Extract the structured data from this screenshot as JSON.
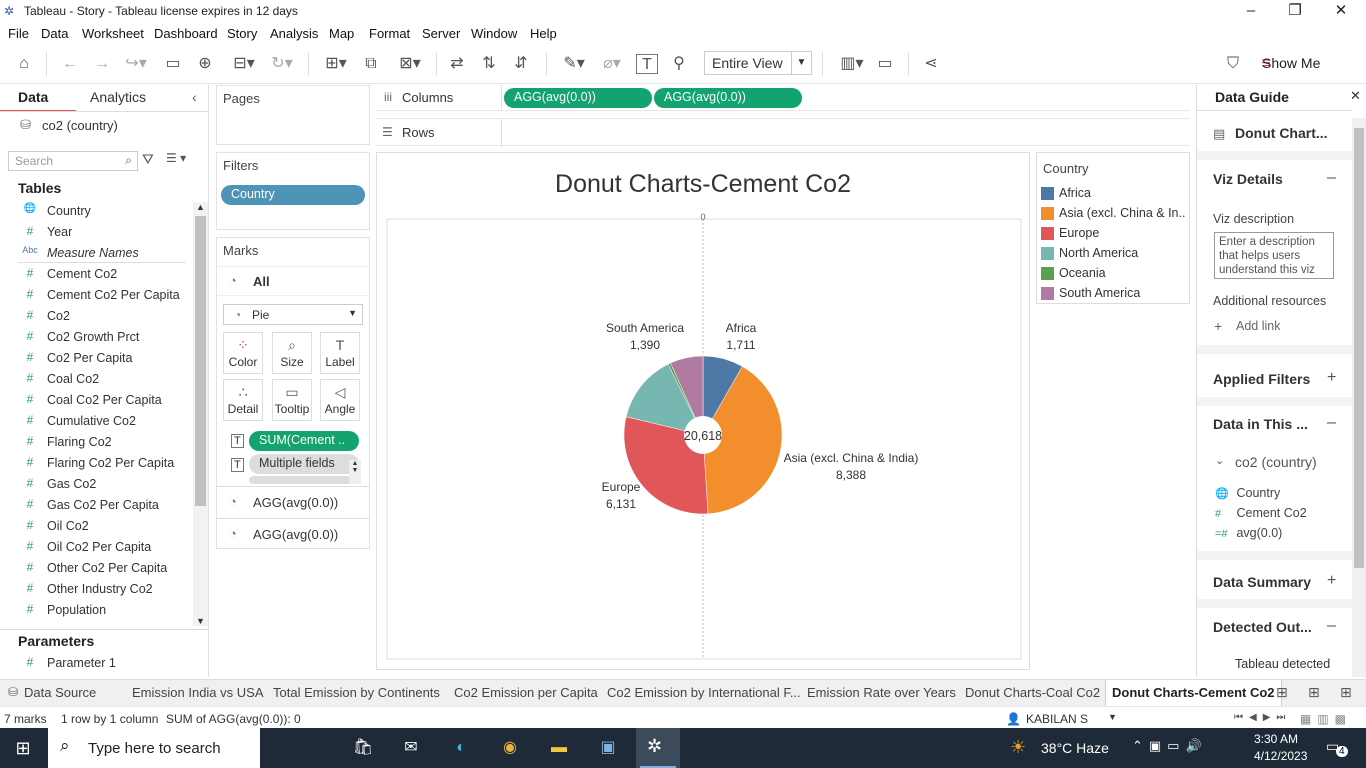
{
  "window": {
    "title": "Tableau - Story - Tableau license expires in 12 days"
  },
  "menu": [
    "File",
    "Data",
    "Worksheet",
    "Dashboard",
    "Story",
    "Analysis",
    "Map",
    "Format",
    "Server",
    "Window",
    "Help"
  ],
  "toolbar": {
    "fit_value": "Entire View",
    "show_me_label": "Show Me"
  },
  "data_pane": {
    "tab_data": "Data",
    "tab_analytics": "Analytics",
    "datasource": "co2 (country)",
    "search_placeholder": "Search",
    "tables_header": "Tables",
    "fields": [
      {
        "icon": "globe",
        "name": "Country"
      },
      {
        "icon": "#",
        "name": "Year"
      },
      {
        "icon": "Abc",
        "name": "Measure Names"
      },
      {
        "icon": "#",
        "name": "Cement Co2"
      },
      {
        "icon": "#",
        "name": "Cement Co2 Per Capita"
      },
      {
        "icon": "#",
        "name": "Co2"
      },
      {
        "icon": "#",
        "name": "Co2 Growth Prct"
      },
      {
        "icon": "#",
        "name": "Co2 Per Capita"
      },
      {
        "icon": "#",
        "name": "Coal Co2"
      },
      {
        "icon": "#",
        "name": "Coal Co2 Per Capita"
      },
      {
        "icon": "#",
        "name": "Cumulative Co2"
      },
      {
        "icon": "#",
        "name": "Flaring Co2"
      },
      {
        "icon": "#",
        "name": "Flaring Co2 Per Capita"
      },
      {
        "icon": "#",
        "name": "Gas Co2"
      },
      {
        "icon": "#",
        "name": "Gas Co2 Per Capita"
      },
      {
        "icon": "#",
        "name": "Oil Co2"
      },
      {
        "icon": "#",
        "name": "Oil Co2 Per Capita"
      },
      {
        "icon": "#",
        "name": "Other Co2 Per Capita"
      },
      {
        "icon": "#",
        "name": "Other Industry Co2"
      },
      {
        "icon": "#",
        "name": "Population"
      }
    ],
    "parameters_header": "Parameters",
    "parameters": [
      "Parameter 1"
    ]
  },
  "shelves": {
    "pages_label": "Pages",
    "filters_label": "Filters",
    "filter_pill": "Country",
    "columns_label": "Columns",
    "rows_label": "Rows",
    "column_pills": [
      "AGG(avg(0.0))",
      "AGG(avg(0.0))"
    ]
  },
  "marks": {
    "label": "Marks",
    "all_label": "All",
    "mark_type": "Pie",
    "buttons": [
      "Color",
      "Size",
      "Label",
      "Detail",
      "Tooltip",
      "Angle"
    ],
    "pills": [
      "SUM(Cement ..",
      "Multiple fields",
      "Multiple fields"
    ],
    "layers": [
      "AGG(avg(0.0))",
      "AGG(avg(0.0))"
    ]
  },
  "viz": {
    "title": "Donut Charts-Cement Co2",
    "axis_zero": "0",
    "center_label": "20,618"
  },
  "chart_data": {
    "type": "pie",
    "title": "Donut Charts-Cement Co2",
    "categories": [
      "Africa",
      "Asia (excl. China & India)",
      "Europe",
      "North America",
      "Oceania",
      "South America"
    ],
    "values": [
      1711,
      8388,
      6131,
      2890,
      108,
      1390
    ],
    "data_labels": [
      {
        "category": "Africa",
        "name": "Africa",
        "value": "1,711"
      },
      {
        "category": "Asia (excl. China & India)",
        "name": "Asia (excl. China & India)",
        "value": "8,388"
      },
      {
        "category": "Europe",
        "name": "Europe",
        "value": "6,131"
      },
      {
        "category": "South America",
        "name": "South America",
        "value": "1,390"
      }
    ],
    "total_label": "20,618",
    "colors": [
      "#4e79a7",
      "#f28e2b",
      "#e15759",
      "#76b7b2",
      "#59a14f",
      "#b07aa1"
    ],
    "legend": "right"
  },
  "legend": {
    "title": "Country",
    "items": [
      {
        "label": "Africa",
        "color": "#4e79a7"
      },
      {
        "label": "Asia (excl. China & In..",
        "color": "#f28e2b"
      },
      {
        "label": "Europe",
        "color": "#e15759"
      },
      {
        "label": "North America",
        "color": "#76b7b2"
      },
      {
        "label": "Oceania",
        "color": "#59a14f"
      },
      {
        "label": "South America",
        "color": "#b07aa1"
      }
    ]
  },
  "data_guide": {
    "title": "Data Guide",
    "sheet_name": "Donut Chart...",
    "viz_details": "Viz Details",
    "viz_description_label": "Viz description",
    "viz_description_placeholder": "Enter a description that helps users understand this viz",
    "additional_resources": "Additional resources",
    "add_link": "Add link",
    "applied_filters": "Applied Filters",
    "data_in_this": "Data in This ...",
    "datasource": "co2 (country)",
    "fields": [
      {
        "icon": "globe",
        "name": "Country"
      },
      {
        "icon": "#",
        "name": "Cement Co2"
      },
      {
        "icon": "=#",
        "name": "avg(0.0)"
      }
    ],
    "data_summary": "Data Summary",
    "detected_outliers": "Detected Out...",
    "outlier_text": "Tableau detected"
  },
  "sheet_tabs": {
    "data_source": "Data Source",
    "tabs": [
      "Emission India vs USA",
      "Total Emission by Continents",
      "Co2 Emission per Capita",
      "Co2 Emission by International F...",
      "Emission Rate over Years",
      "Donut Charts-Coal Co2",
      "Donut Charts-Cement Co2"
    ],
    "active_index": 6
  },
  "status": {
    "marks": "7 marks",
    "dims": "1 row by 1 column",
    "sum": "SUM of AGG(avg(0.0)): 0",
    "user": "KABILAN S"
  },
  "taskbar": {
    "search_placeholder": "Type here to search",
    "weather": "38°C  Haze",
    "time": "3:30 AM",
    "date": "4/12/2023",
    "notifications": "4"
  }
}
